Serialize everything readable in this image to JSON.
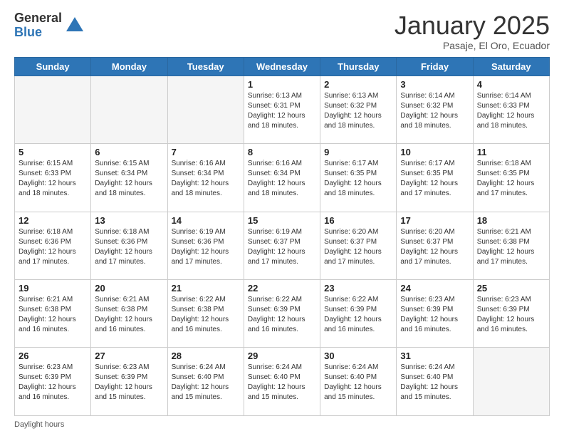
{
  "logo": {
    "general": "General",
    "blue": "Blue"
  },
  "title": "January 2025",
  "subtitle": "Pasaje, El Oro, Ecuador",
  "days_of_week": [
    "Sunday",
    "Monday",
    "Tuesday",
    "Wednesday",
    "Thursday",
    "Friday",
    "Saturday"
  ],
  "footer": {
    "daylight_label": "Daylight hours"
  },
  "weeks": [
    {
      "days": [
        {
          "number": "",
          "info": "",
          "empty": true
        },
        {
          "number": "",
          "info": "",
          "empty": true
        },
        {
          "number": "",
          "info": "",
          "empty": true
        },
        {
          "number": "1",
          "info": "Sunrise: 6:13 AM\nSunset: 6:31 PM\nDaylight: 12 hours\nand 18 minutes."
        },
        {
          "number": "2",
          "info": "Sunrise: 6:13 AM\nSunset: 6:32 PM\nDaylight: 12 hours\nand 18 minutes."
        },
        {
          "number": "3",
          "info": "Sunrise: 6:14 AM\nSunset: 6:32 PM\nDaylight: 12 hours\nand 18 minutes."
        },
        {
          "number": "4",
          "info": "Sunrise: 6:14 AM\nSunset: 6:33 PM\nDaylight: 12 hours\nand 18 minutes."
        }
      ]
    },
    {
      "days": [
        {
          "number": "5",
          "info": "Sunrise: 6:15 AM\nSunset: 6:33 PM\nDaylight: 12 hours\nand 18 minutes."
        },
        {
          "number": "6",
          "info": "Sunrise: 6:15 AM\nSunset: 6:34 PM\nDaylight: 12 hours\nand 18 minutes."
        },
        {
          "number": "7",
          "info": "Sunrise: 6:16 AM\nSunset: 6:34 PM\nDaylight: 12 hours\nand 18 minutes."
        },
        {
          "number": "8",
          "info": "Sunrise: 6:16 AM\nSunset: 6:34 PM\nDaylight: 12 hours\nand 18 minutes."
        },
        {
          "number": "9",
          "info": "Sunrise: 6:17 AM\nSunset: 6:35 PM\nDaylight: 12 hours\nand 18 minutes."
        },
        {
          "number": "10",
          "info": "Sunrise: 6:17 AM\nSunset: 6:35 PM\nDaylight: 12 hours\nand 17 minutes."
        },
        {
          "number": "11",
          "info": "Sunrise: 6:18 AM\nSunset: 6:35 PM\nDaylight: 12 hours\nand 17 minutes."
        }
      ]
    },
    {
      "days": [
        {
          "number": "12",
          "info": "Sunrise: 6:18 AM\nSunset: 6:36 PM\nDaylight: 12 hours\nand 17 minutes."
        },
        {
          "number": "13",
          "info": "Sunrise: 6:18 AM\nSunset: 6:36 PM\nDaylight: 12 hours\nand 17 minutes."
        },
        {
          "number": "14",
          "info": "Sunrise: 6:19 AM\nSunset: 6:36 PM\nDaylight: 12 hours\nand 17 minutes."
        },
        {
          "number": "15",
          "info": "Sunrise: 6:19 AM\nSunset: 6:37 PM\nDaylight: 12 hours\nand 17 minutes."
        },
        {
          "number": "16",
          "info": "Sunrise: 6:20 AM\nSunset: 6:37 PM\nDaylight: 12 hours\nand 17 minutes."
        },
        {
          "number": "17",
          "info": "Sunrise: 6:20 AM\nSunset: 6:37 PM\nDaylight: 12 hours\nand 17 minutes."
        },
        {
          "number": "18",
          "info": "Sunrise: 6:21 AM\nSunset: 6:38 PM\nDaylight: 12 hours\nand 17 minutes."
        }
      ]
    },
    {
      "days": [
        {
          "number": "19",
          "info": "Sunrise: 6:21 AM\nSunset: 6:38 PM\nDaylight: 12 hours\nand 16 minutes."
        },
        {
          "number": "20",
          "info": "Sunrise: 6:21 AM\nSunset: 6:38 PM\nDaylight: 12 hours\nand 16 minutes."
        },
        {
          "number": "21",
          "info": "Sunrise: 6:22 AM\nSunset: 6:38 PM\nDaylight: 12 hours\nand 16 minutes."
        },
        {
          "number": "22",
          "info": "Sunrise: 6:22 AM\nSunset: 6:39 PM\nDaylight: 12 hours\nand 16 minutes."
        },
        {
          "number": "23",
          "info": "Sunrise: 6:22 AM\nSunset: 6:39 PM\nDaylight: 12 hours\nand 16 minutes."
        },
        {
          "number": "24",
          "info": "Sunrise: 6:23 AM\nSunset: 6:39 PM\nDaylight: 12 hours\nand 16 minutes."
        },
        {
          "number": "25",
          "info": "Sunrise: 6:23 AM\nSunset: 6:39 PM\nDaylight: 12 hours\nand 16 minutes."
        }
      ]
    },
    {
      "days": [
        {
          "number": "26",
          "info": "Sunrise: 6:23 AM\nSunset: 6:39 PM\nDaylight: 12 hours\nand 16 minutes."
        },
        {
          "number": "27",
          "info": "Sunrise: 6:23 AM\nSunset: 6:39 PM\nDaylight: 12 hours\nand 15 minutes."
        },
        {
          "number": "28",
          "info": "Sunrise: 6:24 AM\nSunset: 6:40 PM\nDaylight: 12 hours\nand 15 minutes."
        },
        {
          "number": "29",
          "info": "Sunrise: 6:24 AM\nSunset: 6:40 PM\nDaylight: 12 hours\nand 15 minutes."
        },
        {
          "number": "30",
          "info": "Sunrise: 6:24 AM\nSunset: 6:40 PM\nDaylight: 12 hours\nand 15 minutes."
        },
        {
          "number": "31",
          "info": "Sunrise: 6:24 AM\nSunset: 6:40 PM\nDaylight: 12 hours\nand 15 minutes."
        },
        {
          "number": "",
          "info": "",
          "empty": true
        }
      ]
    }
  ]
}
